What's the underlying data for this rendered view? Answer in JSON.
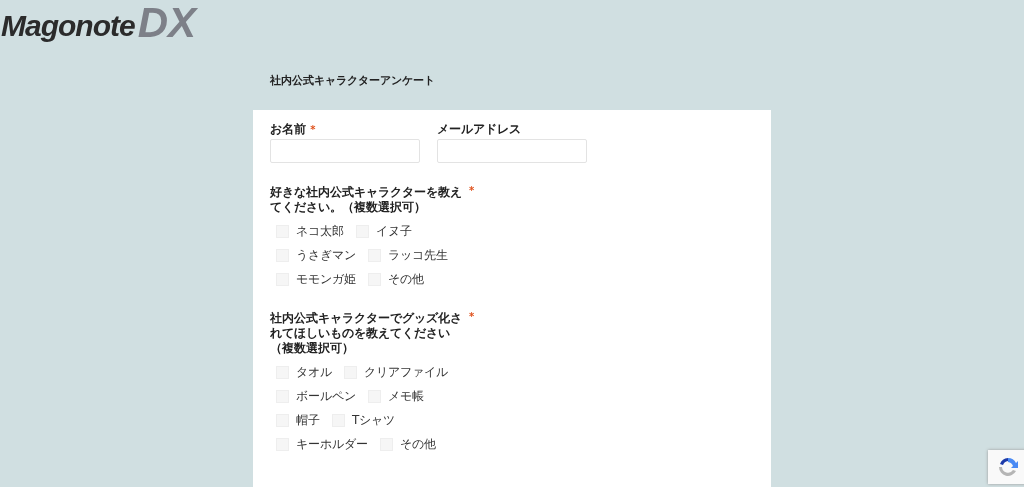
{
  "logo": {
    "word": "Magonote",
    "mark": "DX"
  },
  "form": {
    "title": "社内公式キャラクターアンケート",
    "fields": [
      {
        "label": "お名前",
        "required_mark": "*"
      },
      {
        "label": "メールアドレス"
      }
    ],
    "questions": [
      {
        "label": "好きな社内公式キャラクターを教えてください。（複数選択可）",
        "required_mark": "*",
        "options": [
          {
            "label": "ネコ太郎",
            "checked": false
          },
          {
            "label": "イヌ子",
            "checked": false
          },
          {
            "label": "うさぎマン",
            "checked": false
          },
          {
            "label": "ラッコ先生",
            "checked": false
          },
          {
            "label": "モモンガ姫",
            "checked": false
          },
          {
            "label": "その他",
            "checked": false
          }
        ]
      },
      {
        "label": "社内公式キャラクターでグッズ化されてほしいものを教えてください（複数選択可）",
        "required_mark": "*",
        "options": [
          {
            "label": "タオル",
            "checked": false
          },
          {
            "label": "クリアファイル",
            "checked": false
          },
          {
            "label": "ボールペン",
            "checked": false
          },
          {
            "label": "メモ帳",
            "checked": false
          },
          {
            "label": "帽子",
            "checked": false
          },
          {
            "label": "Tシャツ",
            "checked": false
          },
          {
            "label": "キーホルダー",
            "checked": false
          },
          {
            "label": "その他",
            "checked": false
          }
        ]
      }
    ]
  }
}
